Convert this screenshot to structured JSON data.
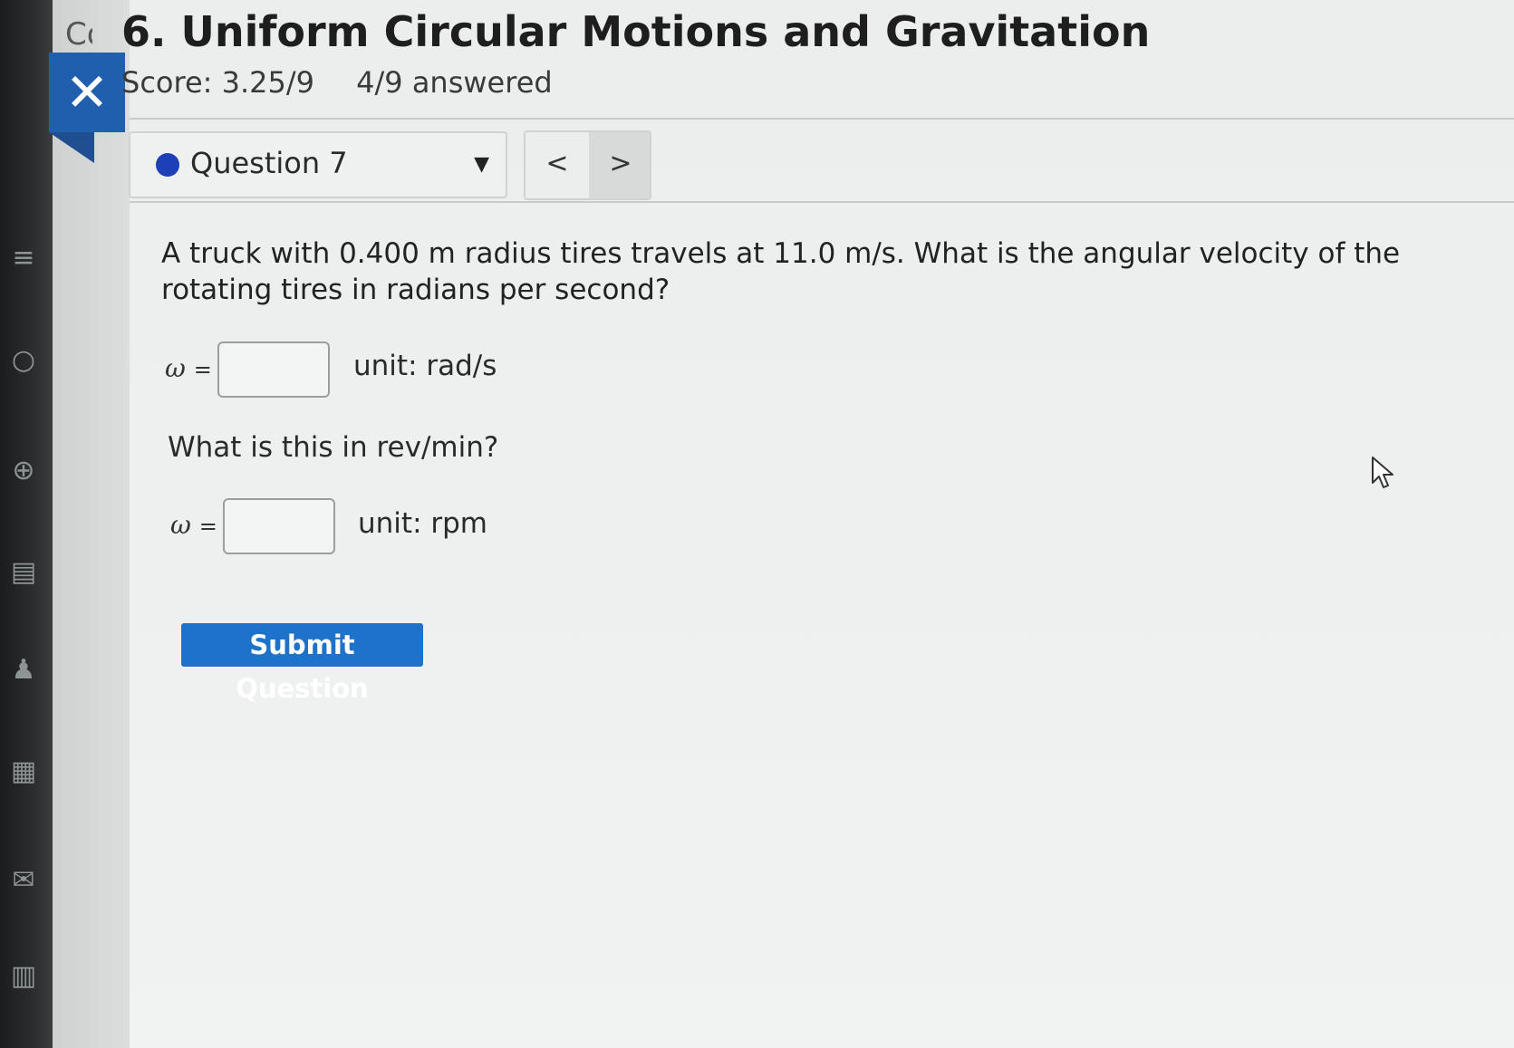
{
  "header": {
    "title_prefix": "Co",
    "title": "6. Uniform Circular Motions and Gravitation",
    "score": "Score: 3.25/9",
    "answered": "4/9 answered",
    "close_icon": "✕"
  },
  "question_nav": {
    "selected_question": "Question 7",
    "prev_label": "<",
    "next_label": ">"
  },
  "question": {
    "text": "A truck with 0.400 m radius tires travels at 11.0 m/s. What is the angular velocity of the rotating tires in radians per second?",
    "part1": {
      "symbol": "ω",
      "equals": "=",
      "value": "",
      "unit": "unit: rad/s"
    },
    "sub_question": "What is this in rev/min?",
    "part2": {
      "symbol": "ω",
      "equals": "=",
      "value": "",
      "unit": "unit: rpm"
    },
    "submit_label": "Submit Question"
  },
  "colors": {
    "accent_blue": "#1f5fae",
    "submit_blue": "#1d72c9",
    "status_dot": "#1d3fb8"
  }
}
